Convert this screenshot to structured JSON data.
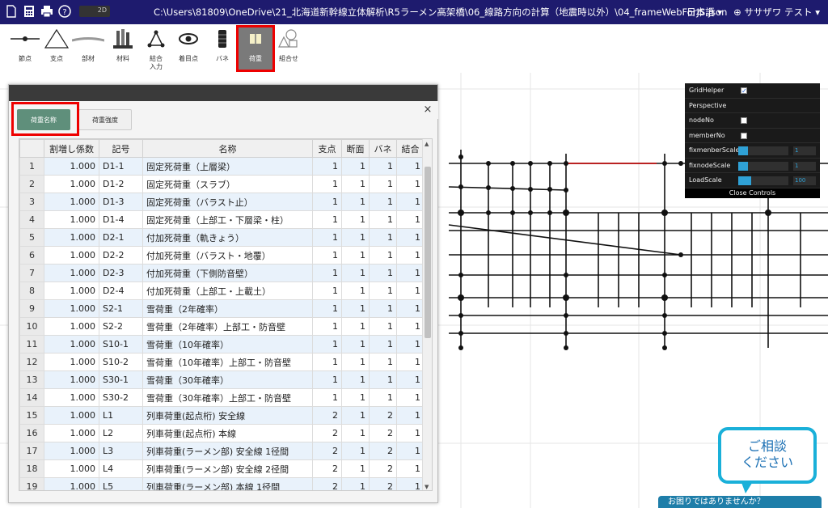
{
  "titlebar": {
    "path": "C:\\Users\\81809\\OneDrive\\21_北海道新幹線立体解析\\R5ラーメン高架橋\\06_線路方向の計算（地震時以外）\\04_frameWebForJS.json",
    "toggle_label": "2D",
    "language": "日本語 ▾",
    "user": "ササザワ テスト ▾"
  },
  "toolbar": {
    "tools": [
      {
        "label": "節点",
        "icon": "node-icon"
      },
      {
        "label": "支点",
        "icon": "support-icon"
      },
      {
        "label": "部材",
        "icon": "member-icon"
      },
      {
        "label": "材料",
        "icon": "material-icon"
      },
      {
        "label": "結合\n入力",
        "icon": "joint-icon"
      },
      {
        "label": "着目点",
        "icon": "eye-icon"
      },
      {
        "label": "バネ",
        "icon": "spring-icon"
      },
      {
        "label": "荷重",
        "icon": "load-icon"
      },
      {
        "label": "組合せ",
        "icon": "combine-icon"
      }
    ]
  },
  "dialog": {
    "close": "×",
    "tab_names": "荷重名称",
    "tab_strength": "荷重強度",
    "columns": [
      "",
      "割増し係数",
      "記号",
      "名称",
      "支点",
      "断面",
      "バネ",
      "結合"
    ],
    "rows": [
      {
        "no": "1",
        "factor": "1.000",
        "code": "D1-1",
        "name": "固定死荷重（上層梁）",
        "support": "1",
        "section": "1",
        "spring": "1",
        "joint": "1"
      },
      {
        "no": "2",
        "factor": "1.000",
        "code": "D1-2",
        "name": "固定死荷重（スラブ）",
        "support": "1",
        "section": "1",
        "spring": "1",
        "joint": "1"
      },
      {
        "no": "3",
        "factor": "1.000",
        "code": "D1-3",
        "name": "固定死荷重（バラスト止）",
        "support": "1",
        "section": "1",
        "spring": "1",
        "joint": "1"
      },
      {
        "no": "4",
        "factor": "1.000",
        "code": "D1-4",
        "name": "固定死荷重（上部工・下層梁・柱）",
        "support": "1",
        "section": "1",
        "spring": "1",
        "joint": "1"
      },
      {
        "no": "5",
        "factor": "1.000",
        "code": "D2-1",
        "name": "付加死荷重（軌きょう）",
        "support": "1",
        "section": "1",
        "spring": "1",
        "joint": "1"
      },
      {
        "no": "6",
        "factor": "1.000",
        "code": "D2-2",
        "name": "付加死荷重（バラスト・地覆）",
        "support": "1",
        "section": "1",
        "spring": "1",
        "joint": "1"
      },
      {
        "no": "7",
        "factor": "1.000",
        "code": "D2-3",
        "name": "付加死荷重（下側防音壁）",
        "support": "1",
        "section": "1",
        "spring": "1",
        "joint": "1"
      },
      {
        "no": "8",
        "factor": "1.000",
        "code": "D2-4",
        "name": "付加死荷重（上部工・上載土）",
        "support": "1",
        "section": "1",
        "spring": "1",
        "joint": "1"
      },
      {
        "no": "9",
        "factor": "1.000",
        "code": "S2-1",
        "name": "雪荷重（2年確率）",
        "support": "1",
        "section": "1",
        "spring": "1",
        "joint": "1"
      },
      {
        "no": "10",
        "factor": "1.000",
        "code": "S2-2",
        "name": "雪荷重（2年確率）上部工・防音壁",
        "support": "1",
        "section": "1",
        "spring": "1",
        "joint": "1"
      },
      {
        "no": "11",
        "factor": "1.000",
        "code": "S10-1",
        "name": "雪荷重（10年確率）",
        "support": "1",
        "section": "1",
        "spring": "1",
        "joint": "1"
      },
      {
        "no": "12",
        "factor": "1.000",
        "code": "S10-2",
        "name": "雪荷重（10年確率）上部工・防音壁",
        "support": "1",
        "section": "1",
        "spring": "1",
        "joint": "1"
      },
      {
        "no": "13",
        "factor": "1.000",
        "code": "S30-1",
        "name": "雪荷重（30年確率）",
        "support": "1",
        "section": "1",
        "spring": "1",
        "joint": "1"
      },
      {
        "no": "14",
        "factor": "1.000",
        "code": "S30-2",
        "name": "雪荷重（30年確率）上部工・防音壁",
        "support": "1",
        "section": "1",
        "spring": "1",
        "joint": "1"
      },
      {
        "no": "15",
        "factor": "1.000",
        "code": "L1",
        "name": "列車荷重(起点桁) 安全線",
        "support": "2",
        "section": "1",
        "spring": "2",
        "joint": "1"
      },
      {
        "no": "16",
        "factor": "1.000",
        "code": "L2",
        "name": "列車荷重(起点桁) 本線",
        "support": "2",
        "section": "1",
        "spring": "2",
        "joint": "1"
      },
      {
        "no": "17",
        "factor": "1.000",
        "code": "L3",
        "name": "列車荷重(ラーメン部) 安全線 1径間",
        "support": "2",
        "section": "1",
        "spring": "2",
        "joint": "1"
      },
      {
        "no": "18",
        "factor": "1.000",
        "code": "L4",
        "name": "列車荷重(ラーメン部) 安全線 2径間",
        "support": "2",
        "section": "1",
        "spring": "2",
        "joint": "1"
      },
      {
        "no": "19",
        "factor": "1.000",
        "code": "L5",
        "name": "列車荷重(ラーメン部) 本線 1径間",
        "support": "2",
        "section": "1",
        "spring": "2",
        "joint": "1"
      }
    ]
  },
  "controls": {
    "grid_helper": "GridHelper",
    "perspective": "Perspective",
    "node_no": "nodeNo",
    "member_no": "memberNo",
    "fix_member_scale": "fixmenberScale",
    "fix_member_value": "1",
    "fix_node_scale": "fixnodeScale",
    "fix_node_value": "1",
    "load_scale": "LoadScale",
    "load_value": "100",
    "close": "Close Controls"
  },
  "chat": {
    "line1": "ご相談",
    "line2": "ください",
    "help": "お困りではありませんか？"
  }
}
